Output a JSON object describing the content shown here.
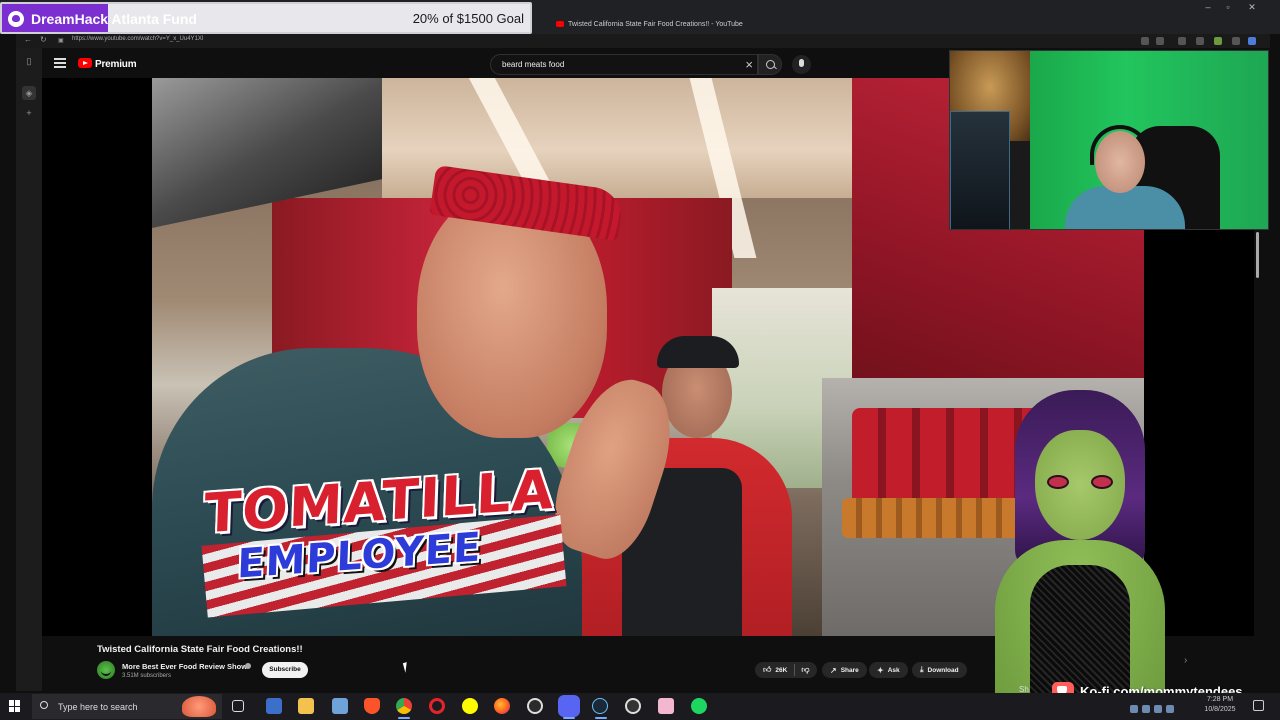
{
  "donation": {
    "title": "DreamHack Atlanta Fund",
    "goal_text": "20% of $1500 Goal",
    "progress_fraction": 0.2,
    "accent_color": "#7c2fd1"
  },
  "browser": {
    "tab_title": "Twisted California State Fair Food Creations!! - YouTube",
    "url": "https://www.youtube.com/watch?v=Y_x_Uu4Y1Xl"
  },
  "youtube": {
    "brand_label": "Premium",
    "search_value": "beard meats food",
    "brand_color": "#ff0000"
  },
  "video": {
    "overlay_line1": "TOMATILLA",
    "overlay_line2": "EMPLOYEE",
    "title": "Twisted California State Fair Food Creations!!"
  },
  "channel": {
    "name": "More Best Ever Food Review Show",
    "subscribers": "3.51M subscribers",
    "subscribe_label": "Subscribe"
  },
  "actions": {
    "likes": "26K",
    "share_label": "Share",
    "ask_label": "Ask",
    "download_label": "Download",
    "partial_label": "Sh"
  },
  "kofi": {
    "text": "Ko-fi.com/mommytendees"
  },
  "taskbar": {
    "search_placeholder": "Type here to search",
    "time": "7:28 PM",
    "date": "10/8/2025",
    "icons": [
      "windows-start-icon",
      "search-icon",
      "task-view-icon",
      "calculator-icon",
      "file-explorer-icon",
      "notepad-icon",
      "brave-icon",
      "chrome-icon",
      "opera-icon",
      "snapchat-icon",
      "firefox-icon",
      "obs-icon",
      "discord-icon",
      "steam-icon",
      "media-icon",
      "pink-app-icon",
      "spotify-icon"
    ]
  }
}
